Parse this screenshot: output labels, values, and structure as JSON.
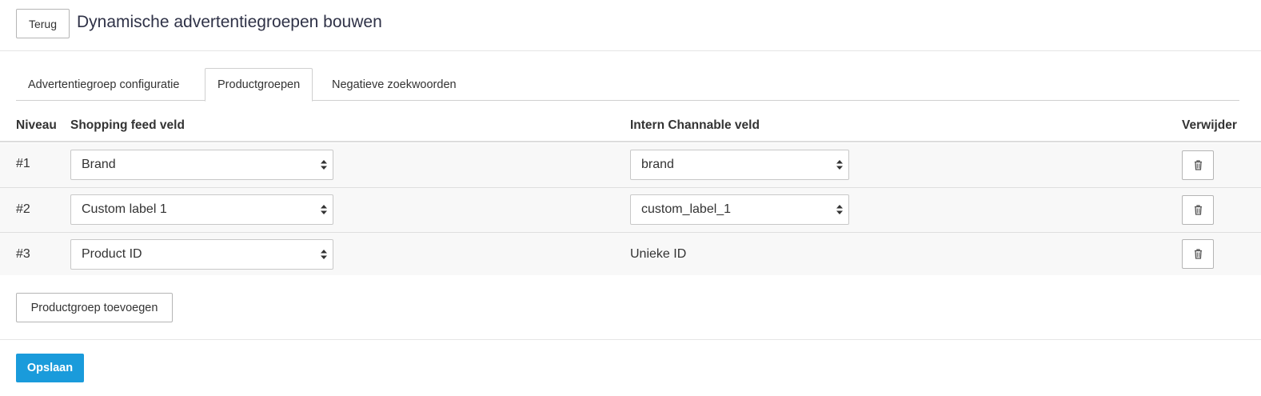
{
  "header": {
    "back_label": "Terug",
    "title": "Dynamische advertentiegroepen bouwen"
  },
  "tabs": [
    {
      "label": "Advertentiegroep configuratie",
      "active": false
    },
    {
      "label": "Productgroepen",
      "active": true
    },
    {
      "label": "Negatieve zoekwoorden",
      "active": false
    }
  ],
  "table": {
    "columns": {
      "level": "Niveau",
      "feed_field": "Shopping feed veld",
      "internal_field": "Intern Channable veld",
      "delete": "Verwijder"
    },
    "rows": [
      {
        "level": "#1",
        "feed_field": "Brand",
        "internal_field": "brand",
        "internal_is_select": true
      },
      {
        "level": "#2",
        "feed_field": "Custom label 1",
        "internal_field": "custom_label_1",
        "internal_is_select": true
      },
      {
        "level": "#3",
        "feed_field": "Product ID",
        "internal_field": "Unieke ID",
        "internal_is_select": false
      }
    ]
  },
  "actions": {
    "add_label": "Productgroep toevoegen",
    "save_label": "Opslaan"
  },
  "icons": {
    "delete": "trash-icon",
    "select_caret": "sort-caret-icon"
  },
  "colors": {
    "primary": "#1a9bdb",
    "row_background": "#f8f8f8",
    "title": "#2f3247"
  }
}
